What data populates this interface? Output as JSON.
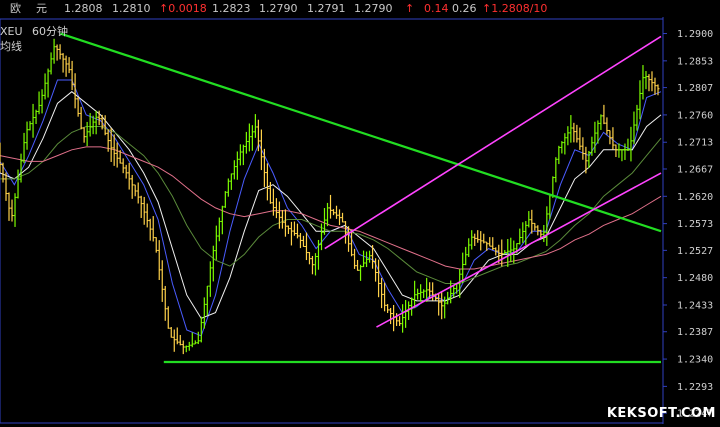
{
  "quote_bar": {
    "name": "欧",
    "name2": "元",
    "open": "1.2808",
    "last": "1.2810",
    "change": "↑0.0018",
    "high": "1.2823",
    "low": "1.2790",
    "prev": "1.2791",
    "bid": "1.2790",
    "arrow": "↑",
    "pct": "0.14",
    "amp": "0.26",
    "ask": "↑1.2808/10"
  },
  "chart_title": {
    "symbol": "XEU",
    "period": "60分钟",
    "sub": "均线"
  },
  "colors": {
    "up": "#7cfc00",
    "down": "#ffd24a",
    "trendline": "#22dd22",
    "channel": "#ff44ff",
    "ma_white": "#f0f0f0",
    "ma_blue": "#4a5cff",
    "ma_green": "#5a8a3a",
    "ma_pink": "#e0708a",
    "axis": "#3040c0"
  },
  "watermark": "KEKSOFT.COM",
  "chart_data": {
    "type": "line",
    "title": "XEU 60分钟",
    "ylim": [
      1.223,
      1.2925
    ],
    "y_ticks": [
      "1.2900",
      "1.2853",
      "1.2807",
      "1.2760",
      "1.2713",
      "1.2667",
      "1.2620",
      "1.2573",
      "1.2527",
      "1.2480",
      "1.2433",
      "1.2387",
      "1.2340",
      "1.2293",
      "1.2247"
    ],
    "x": [
      0,
      5,
      10,
      15,
      20,
      25,
      30,
      35,
      40,
      45,
      50,
      55,
      60,
      65,
      70,
      75,
      80,
      85,
      90,
      95,
      100,
      105,
      110,
      115,
      120,
      125,
      130,
      135,
      140,
      145,
      150,
      155,
      160,
      165,
      170,
      175,
      180,
      185,
      190,
      195,
      200,
      205,
      210,
      215,
      220,
      225,
      230
    ],
    "series": [
      {
        "name": "price",
        "values": [
          1.27,
          1.258,
          1.273,
          1.278,
          1.288,
          1.284,
          1.272,
          1.276,
          1.27,
          1.266,
          1.261,
          1.254,
          1.238,
          1.236,
          1.237,
          1.252,
          1.264,
          1.27,
          1.274,
          1.261,
          1.257,
          1.255,
          1.25,
          1.26,
          1.258,
          1.249,
          1.252,
          1.243,
          1.24,
          1.245,
          1.246,
          1.243,
          1.247,
          1.255,
          1.254,
          1.252,
          1.253,
          1.258,
          1.255,
          1.27,
          1.274,
          1.268,
          1.276,
          1.27,
          1.27,
          1.283,
          1.2805
        ]
      },
      {
        "name": "ma_fast",
        "values": [
          1.268,
          1.264,
          1.269,
          1.275,
          1.282,
          1.282,
          1.276,
          1.275,
          1.272,
          1.268,
          1.264,
          1.258,
          1.247,
          1.239,
          1.238,
          1.245,
          1.256,
          1.265,
          1.271,
          1.266,
          1.26,
          1.257,
          1.253,
          1.256,
          1.257,
          1.252,
          1.251,
          1.246,
          1.242,
          1.243,
          1.245,
          1.244,
          1.246,
          1.251,
          1.253,
          1.252,
          1.2525,
          1.256,
          1.256,
          1.264,
          1.27,
          1.269,
          1.273,
          1.271,
          1.27,
          1.279,
          1.28
        ]
      },
      {
        "name": "ma_mid",
        "values": [
          1.266,
          1.265,
          1.267,
          1.272,
          1.278,
          1.28,
          1.278,
          1.276,
          1.273,
          1.27,
          1.266,
          1.261,
          1.253,
          1.245,
          1.241,
          1.242,
          1.248,
          1.256,
          1.263,
          1.264,
          1.262,
          1.259,
          1.256,
          1.256,
          1.257,
          1.255,
          1.253,
          1.249,
          1.245,
          1.244,
          1.244,
          1.244,
          1.245,
          1.248,
          1.251,
          1.252,
          1.252,
          1.254,
          1.255,
          1.26,
          1.265,
          1.267,
          1.27,
          1.27,
          1.27,
          1.274,
          1.276
        ]
      },
      {
        "name": "ma_slow",
        "values": [
          1.265,
          1.265,
          1.266,
          1.268,
          1.271,
          1.273,
          1.274,
          1.274,
          1.273,
          1.271,
          1.269,
          1.266,
          1.262,
          1.257,
          1.253,
          1.251,
          1.25,
          1.252,
          1.255,
          1.257,
          1.258,
          1.258,
          1.257,
          1.256,
          1.256,
          1.2555,
          1.2545,
          1.253,
          1.251,
          1.249,
          1.248,
          1.247,
          1.247,
          1.248,
          1.249,
          1.25,
          1.2505,
          1.2515,
          1.2525,
          1.2545,
          1.257,
          1.259,
          1.262,
          1.264,
          1.266,
          1.269,
          1.272
        ]
      },
      {
        "name": "ma_long",
        "values": [
          1.269,
          1.2685,
          1.268,
          1.268,
          1.269,
          1.27,
          1.2705,
          1.2705,
          1.27,
          1.269,
          1.268,
          1.267,
          1.2655,
          1.2635,
          1.2615,
          1.26,
          1.259,
          1.2585,
          1.259,
          1.2595,
          1.2595,
          1.259,
          1.258,
          1.257,
          1.2565,
          1.256,
          1.255,
          1.254,
          1.253,
          1.252,
          1.251,
          1.25,
          1.2495,
          1.2495,
          1.25,
          1.2505,
          1.251,
          1.2515,
          1.252,
          1.253,
          1.2545,
          1.2555,
          1.257,
          1.258,
          1.259,
          1.2605,
          1.262
        ]
      }
    ],
    "trendlines": [
      {
        "name": "resistance",
        "from": [
          21,
          1.29
        ],
        "to": [
          230,
          1.256
        ]
      },
      {
        "name": "support",
        "from": [
          57,
          1.2335
        ],
        "to": [
          230,
          1.2335
        ]
      },
      {
        "name": "channel_top",
        "from": [
          113,
          1.253
        ],
        "to": [
          230,
          1.2895
        ]
      },
      {
        "name": "channel_bottom",
        "from": [
          131,
          1.2395
        ],
        "to": [
          230,
          1.266
        ]
      }
    ]
  }
}
